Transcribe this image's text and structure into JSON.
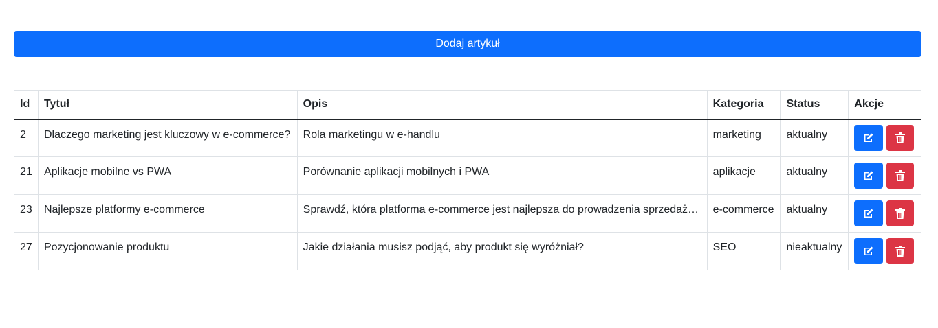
{
  "toolbar": {
    "add_label": "Dodaj artykuł"
  },
  "table": {
    "headers": {
      "id": "Id",
      "title": "Tytuł",
      "desc": "Opis",
      "category": "Kategoria",
      "status": "Status",
      "actions": "Akcje"
    },
    "rows": [
      {
        "id": "2",
        "title": "Dlaczego marketing jest kluczowy w e-commerce?",
        "desc": "Rola marketingu w e-handlu",
        "category": "marketing",
        "status": "aktualny"
      },
      {
        "id": "21",
        "title": "Aplikacje mobilne vs PWA",
        "desc": "Porównanie aplikacji mobilnych i PWA",
        "category": "aplikacje",
        "status": "aktualny"
      },
      {
        "id": "23",
        "title": "Najlepsze platformy e-commerce",
        "desc": "Sprawdź, która platforma e-commerce jest najlepsza do prowadzenia sprzedaży...",
        "category": "e-commerce",
        "status": "aktualny"
      },
      {
        "id": "27",
        "title": "Pozycjonowanie produktu",
        "desc": "Jakie działania musisz podjąć, aby produkt się wyróżniał?",
        "category": "SEO",
        "status": "nieaktualny"
      }
    ]
  },
  "icons": {
    "edit": "edit-icon",
    "delete": "trash-icon"
  },
  "colors": {
    "primary": "#0d6efd",
    "danger": "#dc3545"
  }
}
